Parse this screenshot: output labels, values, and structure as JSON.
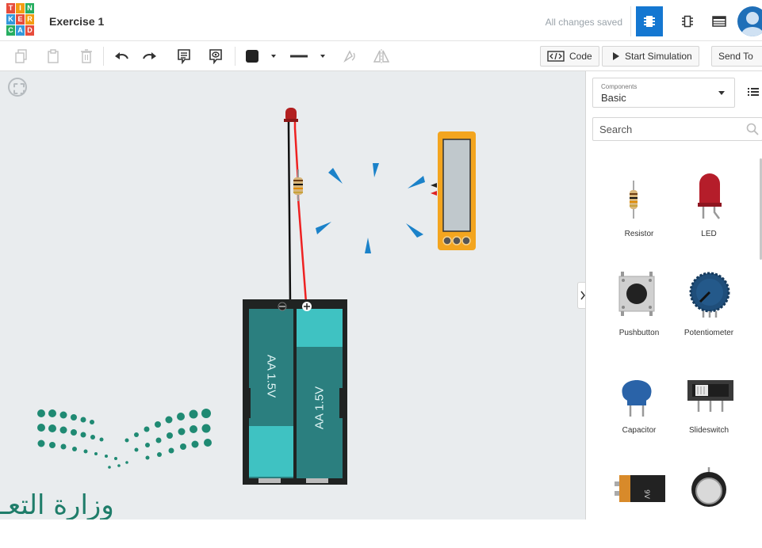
{
  "app": {
    "logo_letters": [
      "T",
      "I",
      "N",
      "K",
      "E",
      "R",
      "C",
      "A",
      "D"
    ],
    "logo_colors": [
      "#e74c3c",
      "#f39c12",
      "#27ae60",
      "#3498db",
      "#e74c3c",
      "#f39c12",
      "#27ae60",
      "#3498db",
      "#e74c3c"
    ],
    "title": "Exercise 1",
    "save_status": "All changes saved"
  },
  "toolbar": {
    "code_label": "Code",
    "start_simulation_label": "Start Simulation",
    "send_to_label": "Send To"
  },
  "panel": {
    "components_caption": "Components",
    "components_value": "Basic",
    "search_placeholder": "Search",
    "items": [
      {
        "label": "Resistor",
        "icon": "resistor-icon"
      },
      {
        "label": "LED",
        "icon": "led-icon"
      },
      {
        "label": "Pushbutton",
        "icon": "pushbutton-icon"
      },
      {
        "label": "Potentiometer",
        "icon": "potentiometer-icon"
      },
      {
        "label": "Capacitor",
        "icon": "capacitor-icon"
      },
      {
        "label": "Slideswitch",
        "icon": "slideswitch-icon"
      },
      {
        "label": "",
        "icon": "9v-battery-icon"
      },
      {
        "label": "",
        "icon": "coin-cell-icon"
      }
    ]
  },
  "canvas": {
    "battery_cell_1_label": "AA 1.5V",
    "battery_cell_2_label": "AA 1.5V"
  },
  "watermark": {
    "arabic_text": "وزارة التعـ"
  },
  "colors": {
    "accent": "#1477d1",
    "teal_cell": "#2b7f7f",
    "teal_light": "#3fc2c2",
    "multimeter": "#f3a51f"
  }
}
